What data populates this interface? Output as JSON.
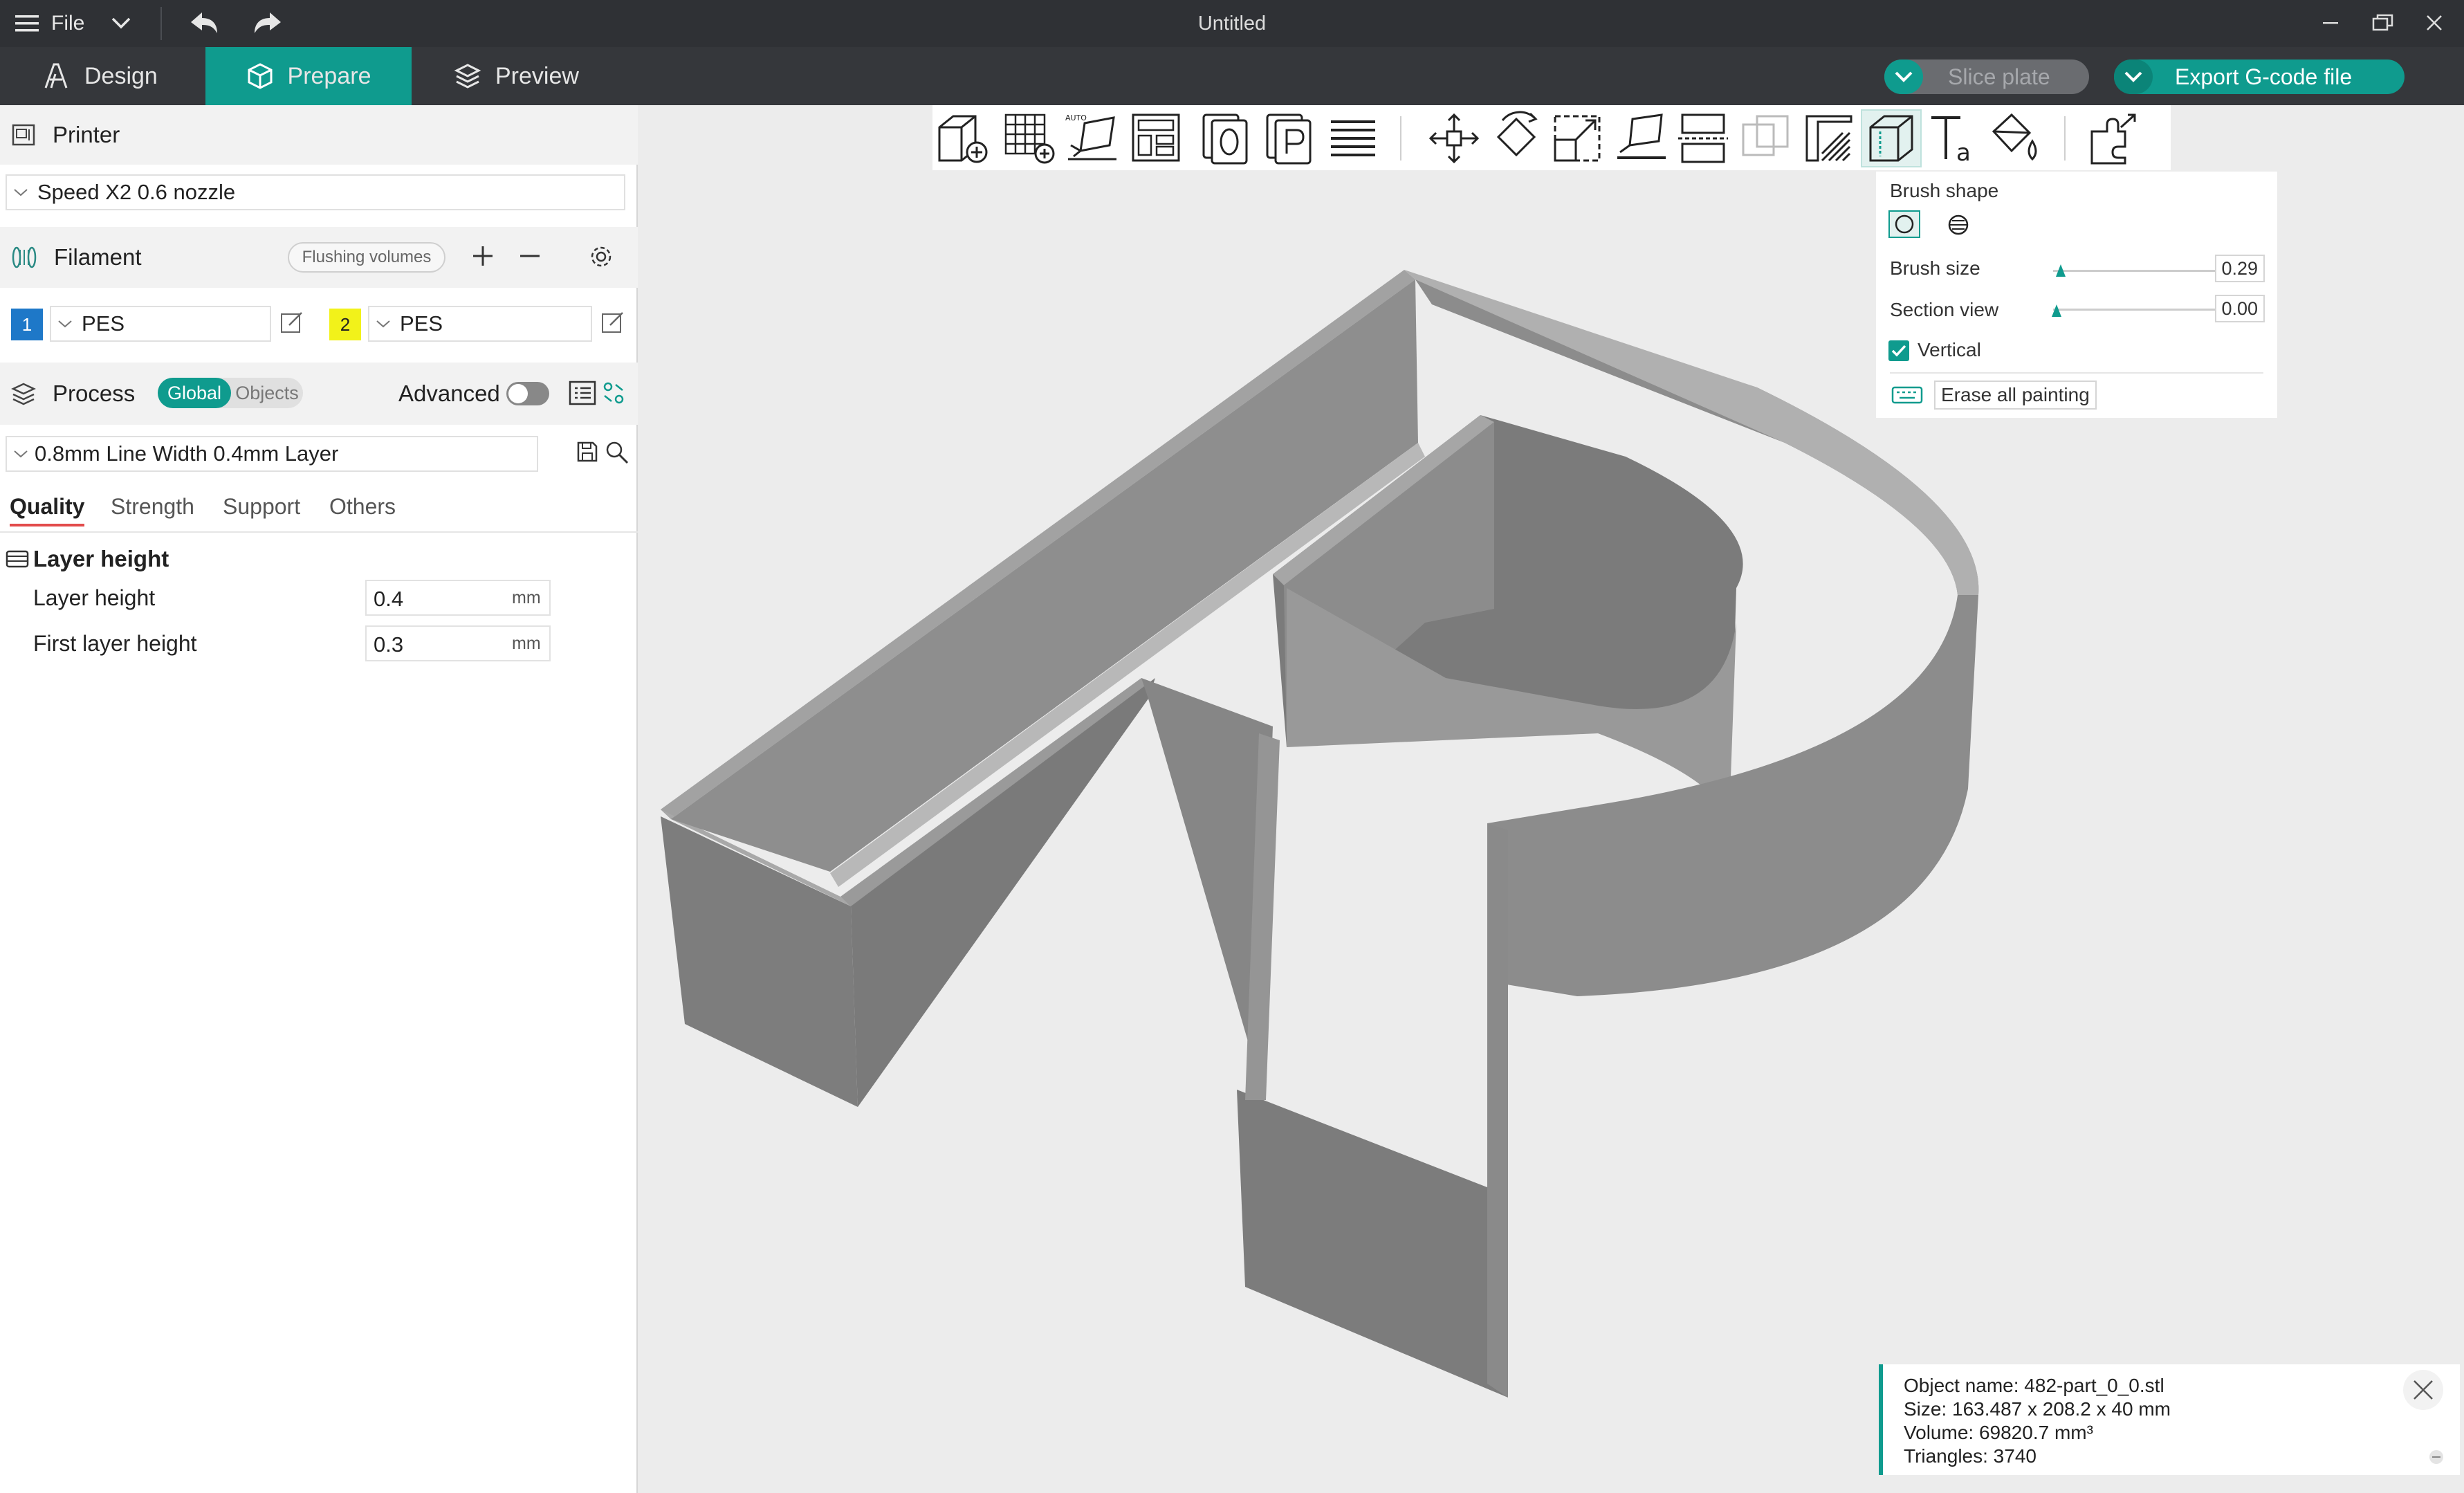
{
  "titlebar": {
    "menu_label": "File",
    "window_title": "Untitled"
  },
  "tabs": {
    "design": "Design",
    "prepare": "Prepare",
    "preview": "Preview"
  },
  "actions": {
    "slice_plate": "Slice plate",
    "export_gcode": "Export G-code file"
  },
  "printer": {
    "section_title": "Printer",
    "selected": "Speed X2 0.6 nozzle"
  },
  "filament": {
    "section_title": "Filament",
    "flushing_volumes": "Flushing volumes",
    "slots": [
      {
        "index": "1",
        "color": "#1e78c8",
        "text_color": "#ffffff",
        "material": "PES"
      },
      {
        "index": "2",
        "color": "#f2f21a",
        "text_color": "#222222",
        "material": "PES"
      }
    ]
  },
  "process": {
    "section_title": "Process",
    "toggle_global": "Global",
    "toggle_objects": "Objects",
    "advanced_label": "Advanced",
    "advanced_on": false,
    "preset": "0.8mm Line Width 0.4mm Layer",
    "tabs": [
      "Quality",
      "Strength",
      "Support",
      "Others"
    ],
    "active_tab": "Quality",
    "group_title": "Layer height",
    "params": [
      {
        "label": "Layer height",
        "value": "0.4",
        "unit": "mm"
      },
      {
        "label": "First layer height",
        "value": "0.3",
        "unit": "mm"
      }
    ]
  },
  "paint_panel": {
    "brush_shape_label": "Brush shape",
    "brush_size_label": "Brush size",
    "brush_size_value": "0.29",
    "section_view_label": "Section view",
    "section_view_value": "0.00",
    "vertical_label": "Vertical",
    "vertical_checked": true,
    "erase_label": "Erase all painting"
  },
  "object_info": {
    "name": "Object name: 482-part_0_0.stl",
    "size": "Size: 163.487 x 208.2 x 40 mm",
    "volume": "Volume: 69820.7 mm³",
    "triangles": "Triangles: 3740"
  },
  "colors": {
    "accent": "#0f9b8e",
    "titlebar_bg": "#2f3135",
    "tabbar_bg": "#35373b",
    "viewport_bg": "#ececec",
    "model_gray": "#8c8c8c"
  },
  "toolbar_icons": [
    "add-object-icon",
    "add-plate-grid-icon",
    "auto-orient-icon",
    "arrange-icon",
    "split-objects-icon",
    "split-parts-icon",
    "layers-icon",
    "move-icon",
    "rotate-icon",
    "scale-icon",
    "lay-on-face-icon",
    "cut-icon",
    "mesh-boolean-icon",
    "support-paint-icon",
    "seam-paint-icon",
    "text-icon",
    "color-paint-icon",
    "assembly-icon"
  ]
}
